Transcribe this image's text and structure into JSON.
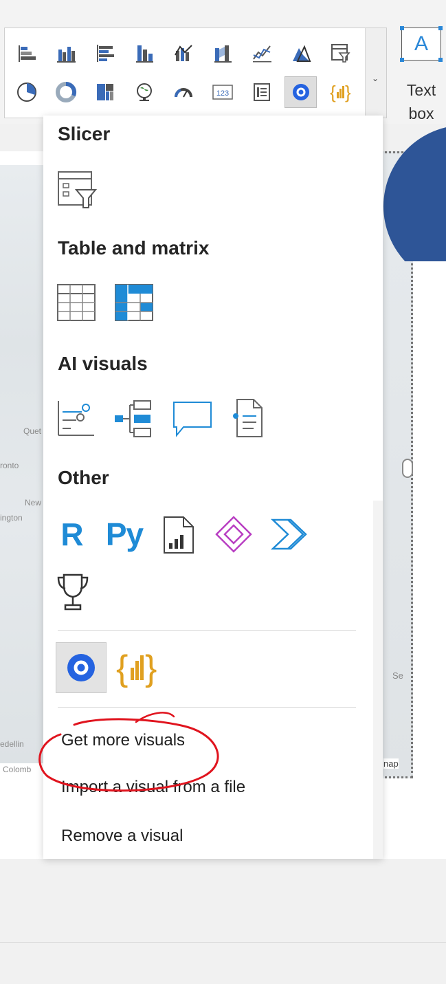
{
  "ribbon": {
    "textbox_label": "Text box",
    "textbox_glyph": "A",
    "gallery_row1": [
      "stacked-bar-icon",
      "clustered-column-icon",
      "clustered-bar-icon",
      "stacked-column-icon",
      "line-column-icon",
      "ribbon-chart-icon",
      "line-chart-icon",
      "area-chart-icon",
      "filter-table-icon"
    ],
    "gallery_row2": [
      "pie-chart-icon",
      "donut-chart-icon",
      "treemap-icon",
      "map-icon",
      "gauge-icon",
      "card-icon",
      "multirow-card-icon",
      "custom-visual-icon",
      "custom-bars-icon"
    ]
  },
  "menu": {
    "slicer_title": "Slicer",
    "table_title": "Table and matrix",
    "ai_title": "AI visuals",
    "other_title": "Other",
    "r_label": "R",
    "py_label": "Py",
    "items": {
      "get_more": "Get more visuals",
      "import": "Import a visual from a file",
      "remove": "Remove a visual"
    }
  },
  "map_labels": {
    "quebec": "Quet",
    "toronto": "ronto",
    "new": "New",
    "washington": "ington",
    "medellin": "edellin",
    "colombia": "Colomb",
    "nap": "nap",
    "se": "Se"
  },
  "colors": {
    "accent_blue": "#1f8bd6",
    "shape_blue": "#2e5597",
    "annotation_red": "#e0141e",
    "gold": "#e0a020",
    "powerapps_purple": "#b83ec2"
  }
}
